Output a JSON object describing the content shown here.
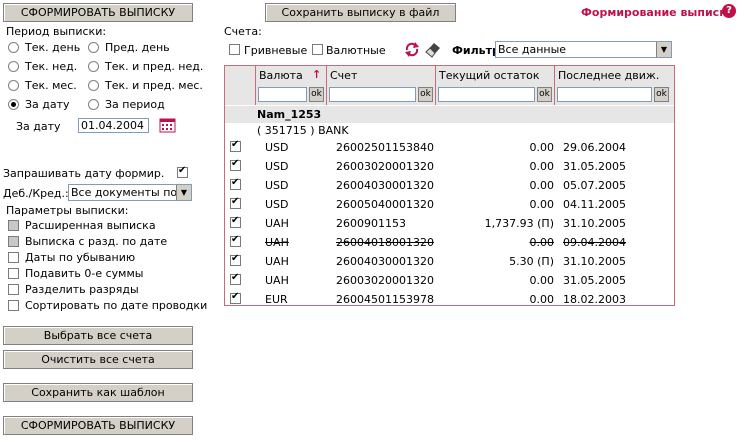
{
  "buttons": {
    "form_top": "СФОРМИРОВАТЬ ВЫПИСКУ",
    "save_file": "Сохранить выписку в файл",
    "select_all": "Выбрать все счета",
    "clear_all": "Очистить все счета",
    "save_template": "Сохранить как шаблон",
    "form_bottom": "СФОРМИРОВАТЬ ВЫПИСКУ"
  },
  "header": {
    "title": "Формирование выписки",
    "help": "?"
  },
  "period": {
    "label": "Период выписки:",
    "options": [
      "Тек. день",
      "Пред. день",
      "Тек. нед.",
      "Тек. и пред. нед.",
      "Тек. мес.",
      "Тек. и пред. мес.",
      "За дату",
      "За период"
    ],
    "selected": "За дату",
    "date_label": "За дату",
    "date_value": "01.04.2004"
  },
  "ask_date": {
    "label": "Запрашивать дату формир.",
    "checked": true
  },
  "debcred": {
    "label": "Деб./Кред.:",
    "value": "Все документы по сч"
  },
  "params": {
    "label": "Параметры выписки:",
    "items": [
      {
        "label": "Расширенная выписка",
        "checked": false,
        "disabled": true
      },
      {
        "label": "Выписка с разд. по дате",
        "checked": false,
        "disabled": true
      },
      {
        "label": "Даты по убыванию",
        "checked": false,
        "disabled": false
      },
      {
        "label": "Подавить 0-е суммы",
        "checked": false,
        "disabled": false
      },
      {
        "label": "Разделить разряды",
        "checked": false,
        "disabled": false
      },
      {
        "label": "Сортировать по дате проводки",
        "checked": false,
        "disabled": false
      }
    ]
  },
  "accounts": {
    "label": "Счета:",
    "hryvnia": "Гривневые",
    "currency": "Валютные",
    "filter_label": "Фильтр",
    "filter_value": "Все данные"
  },
  "table": {
    "columns": [
      "Валюта",
      "Счет",
      "Текущий остаток",
      "Последнее движ."
    ],
    "sort_arrow": "↑",
    "ok": "ok",
    "group_name": "Nam_1253",
    "group_bank": "( 351715 ) BANK",
    "rows": [
      {
        "checked": true,
        "currency": "USD",
        "account": "26002501153840",
        "balance": "0.00",
        "date": "29.06.2004",
        "strike": false
      },
      {
        "checked": true,
        "currency": "USD",
        "account": "26003020001320",
        "balance": "0.00",
        "date": "31.05.2005",
        "strike": false
      },
      {
        "checked": true,
        "currency": "USD",
        "account": "26004030001320",
        "balance": "0.00",
        "date": "05.07.2005",
        "strike": false
      },
      {
        "checked": true,
        "currency": "USD",
        "account": "26005040001320",
        "balance": "0.00",
        "date": "04.11.2005",
        "strike": false
      },
      {
        "checked": true,
        "currency": "UAH",
        "account": "2600901153",
        "balance": "1,737.93 (П)",
        "date": "31.10.2005",
        "strike": false
      },
      {
        "checked": true,
        "currency": "UAH",
        "account": "26004018001320",
        "balance": "0.00",
        "date": "09.04.2004",
        "strike": true
      },
      {
        "checked": true,
        "currency": "UAH",
        "account": "26004030001320",
        "balance": "5.30 (П)",
        "date": "31.10.2005",
        "strike": false
      },
      {
        "checked": true,
        "currency": "UAH",
        "account": "26003020001320",
        "balance": "0.00",
        "date": "31.05.2005",
        "strike": false
      },
      {
        "checked": true,
        "currency": "EUR",
        "account": "26004501153978",
        "balance": "0.00",
        "date": "18.02.2003",
        "strike": false
      }
    ]
  },
  "colors": {
    "accent": "#c0104a",
    "border": "#c96b7a",
    "button": "#d4d0c8"
  }
}
